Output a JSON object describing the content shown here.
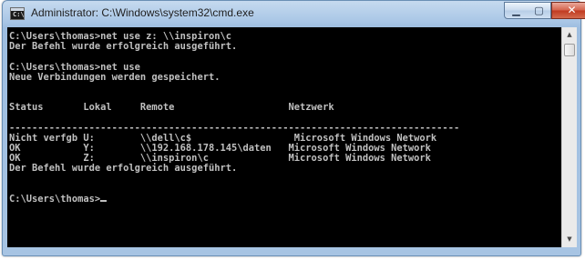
{
  "window": {
    "title": "Administrator: C:\\Windows\\system32\\cmd.exe",
    "icon_text": "C:\\",
    "controls": {
      "minimize_icon": "minimize-icon",
      "maximize_icon": "maximize-icon",
      "close_icon": "close-icon",
      "minimize_glyph": "▁",
      "maximize_glyph": "▢",
      "close_glyph": "✕"
    }
  },
  "console": {
    "background": "#000000",
    "foreground": "#c0c0c0",
    "lines": [
      "C:\\Users\\thomas>net use z: \\\\inspiron\\c",
      "Der Befehl wurde erfolgreich ausgeführt.",
      "",
      "C:\\Users\\thomas>net use",
      "Neue Verbindungen werden gespeichert.",
      "",
      "",
      "Status       Lokal     Remote                    Netzwerk",
      "",
      "-------------------------------------------------------------------------------",
      "Nicht verfgb U:        \\\\dell\\c$                  Microsoft Windows Network",
      "OK           Y:        \\\\192.168.178.145\\daten   Microsoft Windows Network",
      "OK           Z:        \\\\inspiron\\c              Microsoft Windows Network",
      "Der Befehl wurde erfolgreich ausgeführt.",
      "",
      "",
      "C:\\Users\\thomas>"
    ]
  },
  "scrollbar": {
    "up_icon": "scroll-up-icon",
    "down_icon": "scroll-down-icon",
    "up_glyph": "▲",
    "down_glyph": "▼"
  }
}
